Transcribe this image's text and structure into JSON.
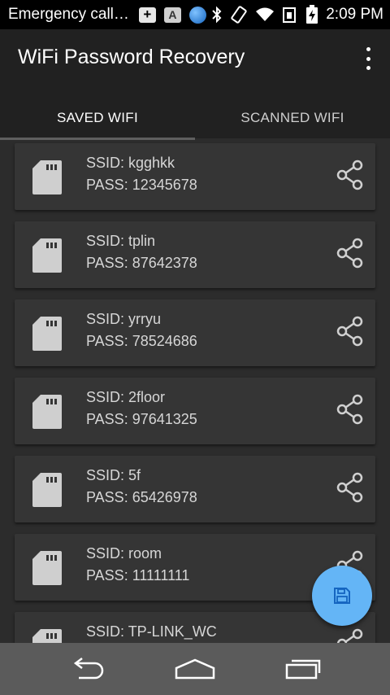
{
  "status_bar": {
    "carrier_text": "Emergency call…",
    "time": "2:09 PM",
    "icons": [
      "plus-icon",
      "a-icon",
      "globe-icon",
      "bluetooth-icon",
      "rotation-icon",
      "wifi-icon",
      "data-icon",
      "battery-charging-icon"
    ],
    "plus_glyph": "+",
    "a_glyph": "A"
  },
  "app_bar": {
    "title": "WiFi Password Recovery",
    "overflow_icon": "more-vert-icon"
  },
  "tabs": [
    {
      "label": "SAVED WIFI",
      "selected": true
    },
    {
      "label": "SCANNED WIFI",
      "selected": false
    }
  ],
  "wifi_list": [
    {
      "ssid": "SSID: kgghkk",
      "pass": "PASS: 12345678"
    },
    {
      "ssid": "SSID: tplin",
      "pass": "PASS: 87642378"
    },
    {
      "ssid": "SSID: yrryu",
      "pass": "PASS: 78524686"
    },
    {
      "ssid": "SSID: 2floor",
      "pass": "PASS: 97641325"
    },
    {
      "ssid": "SSID: 5f",
      "pass": "PASS: 65426978"
    },
    {
      "ssid": "SSID: room",
      "pass": "PASS: 11111111"
    },
    {
      "ssid": "SSID: TP-LINK_WC",
      "pass": ""
    }
  ],
  "fab": {
    "icon": "save-icon",
    "color": "#64b5f6"
  },
  "nav_bar": {
    "buttons": [
      "back-icon",
      "home-icon",
      "recents-icon"
    ]
  },
  "colors": {
    "app_bar": "#212121",
    "background": "#2c2c2c",
    "card": "#353535"
  }
}
